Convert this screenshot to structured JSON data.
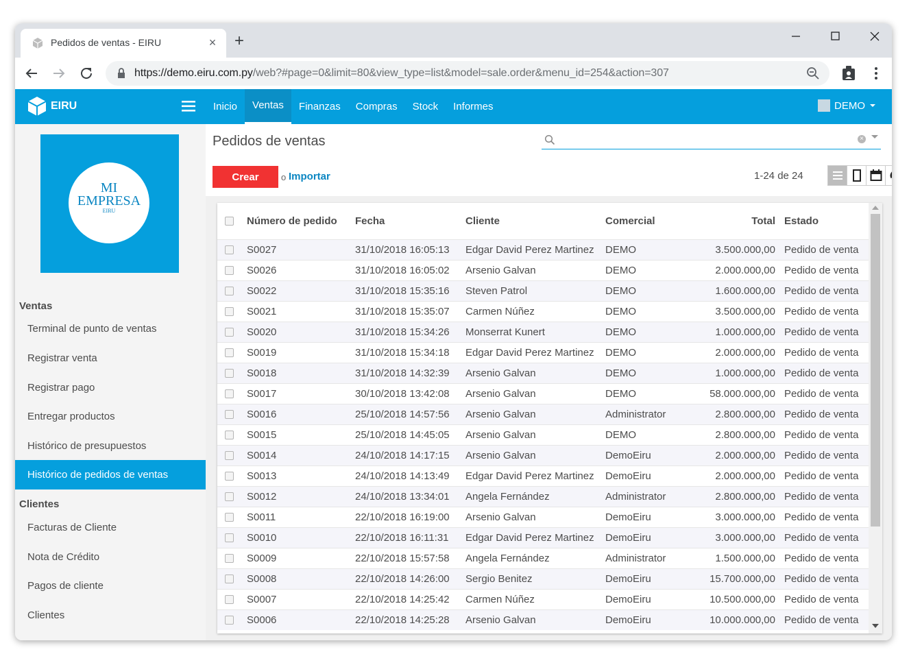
{
  "browser": {
    "tab_title": "Pedidos de ventas - EIRU",
    "tab_close": "×",
    "new_tab": "+",
    "url_host": "https://demo.eiru.com.py",
    "url_rest": "/web?#page=0&limit=80&view_type=list&model=sale.order&menu_id=254&action=307"
  },
  "app": {
    "brand": "EIRU",
    "menu": [
      "Inicio",
      "Ventas",
      "Finanzas",
      "Compras",
      "Stock",
      "Informes"
    ],
    "active_menu": "Ventas",
    "user": "DEMO",
    "accent_color": "#059fdd",
    "create_color": "#f13232"
  },
  "company_logo": {
    "line1": "MI",
    "line2": "EMPRESA",
    "line3": "EIRU"
  },
  "sidebar": {
    "section_ventas": "Ventas",
    "ventas_items": [
      "Terminal de punto de ventas",
      "Registrar venta",
      "Registrar pago",
      "Entregar productos",
      "Histórico de presupuestos",
      "Histórico de pedidos de ventas"
    ],
    "section_clientes": "Clientes",
    "clientes_items": [
      "Facturas de Cliente",
      "Nota de Crédito",
      "Pagos de cliente",
      "Clientes"
    ]
  },
  "main": {
    "title": "Pedidos de ventas",
    "search_value": "",
    "create_label": "Crear",
    "or_label": "o",
    "import_label": "Importar",
    "pager": "1-24 de 24"
  },
  "table": {
    "headers": [
      "Número de pedido",
      "Fecha",
      "Cliente",
      "Comercial",
      "Total",
      "Estado"
    ],
    "rows": [
      [
        "S0027",
        "31/10/2018 16:05:13",
        "Edgar David Perez Martinez",
        "DEMO",
        "3.500.000,00",
        "Pedido de venta"
      ],
      [
        "S0026",
        "31/10/2018 16:05:02",
        "Arsenio Galvan",
        "DEMO",
        "2.000.000,00",
        "Pedido de venta"
      ],
      [
        "S0022",
        "31/10/2018 15:35:16",
        "Steven Patrol",
        "DEMO",
        "1.600.000,00",
        "Pedido de venta"
      ],
      [
        "S0021",
        "31/10/2018 15:35:07",
        "Carmen Núñez",
        "DEMO",
        "3.500.000,00",
        "Pedido de venta"
      ],
      [
        "S0020",
        "31/10/2018 15:34:26",
        "Monserrat Kunert",
        "DEMO",
        "1.000.000,00",
        "Pedido de venta"
      ],
      [
        "S0019",
        "31/10/2018 15:34:18",
        "Edgar David Perez Martinez",
        "DEMO",
        "2.000.000,00",
        "Pedido de venta"
      ],
      [
        "S0018",
        "31/10/2018 14:32:39",
        "Arsenio Galvan",
        "DEMO",
        "1.000.000,00",
        "Pedido de venta"
      ],
      [
        "S0017",
        "30/10/2018 13:42:08",
        "Arsenio Galvan",
        "DEMO",
        "58.000.000,00",
        "Pedido de venta"
      ],
      [
        "S0016",
        "25/10/2018 14:57:56",
        "Arsenio Galvan",
        "Administrator",
        "2.800.000,00",
        "Pedido de venta"
      ],
      [
        "S0015",
        "25/10/2018 14:45:05",
        "Arsenio Galvan",
        "DEMO",
        "2.800.000,00",
        "Pedido de venta"
      ],
      [
        "S0014",
        "24/10/2018 14:17:15",
        "Arsenio Galvan",
        "DemoEiru",
        "2.000.000,00",
        "Pedido de venta"
      ],
      [
        "S0013",
        "24/10/2018 14:13:49",
        "Edgar David Perez Martinez",
        "DemoEiru",
        "2.000.000,00",
        "Pedido de venta"
      ],
      [
        "S0012",
        "24/10/2018 13:34:01",
        "Angela Fernández",
        "Administrator",
        "2.800.000,00",
        "Pedido de venta"
      ],
      [
        "S0011",
        "22/10/2018 16:19:00",
        "Arsenio Galvan",
        "DemoEiru",
        "3.000.000,00",
        "Pedido de venta"
      ],
      [
        "S0010",
        "22/10/2018 16:11:31",
        "Edgar David Perez Martinez",
        "DemoEiru",
        "3.000.000,00",
        "Pedido de venta"
      ],
      [
        "S0009",
        "22/10/2018 15:57:58",
        "Angela Fernández",
        "Administrator",
        "1.500.000,00",
        "Pedido de venta"
      ],
      [
        "S0008",
        "22/10/2018 14:26:00",
        "Sergio Benitez",
        "DemoEiru",
        "15.700.000,00",
        "Pedido de venta"
      ],
      [
        "S0007",
        "22/10/2018 14:25:42",
        "Carmen Núñez",
        "DemoEiru",
        "10.500.000,00",
        "Pedido de venta"
      ],
      [
        "S0006",
        "22/10/2018 14:25:28",
        "Arsenio Galvan",
        "DemoEiru",
        "10.000.000,00",
        "Pedido de venta"
      ]
    ]
  }
}
